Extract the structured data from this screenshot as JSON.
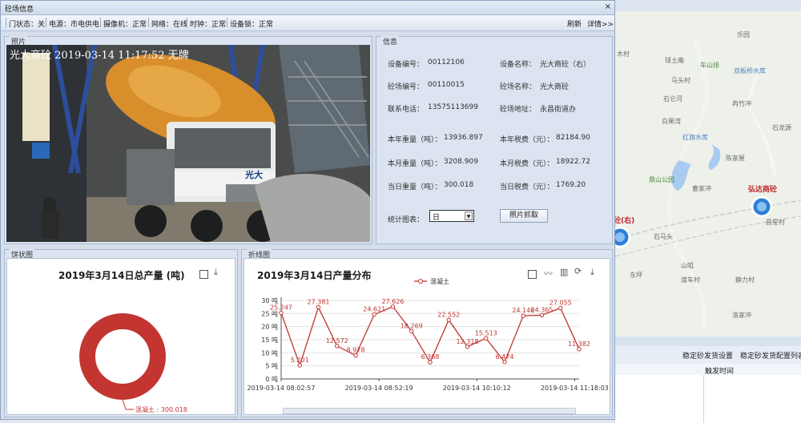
{
  "window": {
    "title": "砼场信息",
    "close": "×"
  },
  "status": {
    "door": "门状态：关",
    "power": "电源：市电供电",
    "camera": "摄像机：正常",
    "network": "网络：在线",
    "clock": "时钟：正常",
    "lock": "设备锁：正常",
    "refresh": "刷新",
    "details": "详情>>"
  },
  "photo": {
    "panel_title": "照片",
    "overlay": "光大商砼 2019-03-14 11:17:52 无牌",
    "truck_text": "光大"
  },
  "info": {
    "panel_title": "信息",
    "fields": [
      {
        "label": "设备编号：",
        "value": "00112106"
      },
      {
        "label": "设备名称：",
        "value": "光大商砼（右）"
      },
      {
        "label": "砼场编号：",
        "value": "00110015"
      },
      {
        "label": "砼场名称：",
        "value": "光大商砼"
      },
      {
        "label": "联系电话：",
        "value": "13575113699"
      },
      {
        "label": "砼场地址：",
        "value": "永昌街道办"
      },
      {
        "label": "本年重量（吨）：",
        "value": "13936.897"
      },
      {
        "label": "本年税费（元）：",
        "value": "82184.90"
      },
      {
        "label": "本月重量（吨）：",
        "value": "3208.909"
      },
      {
        "label": "本月税费（元）：",
        "value": "18922.72"
      },
      {
        "label": "当日重量（吨）：",
        "value": "300.018"
      },
      {
        "label": "当日税费（元）：",
        "value": "1769.20"
      }
    ],
    "stat_label": "统计图表：",
    "stat_value": "日",
    "snap_button": "照片抓取"
  },
  "pie_panel": {
    "panel_title": "饼状图"
  },
  "line_panel": {
    "panel_title": "折线图"
  },
  "map": {
    "labels": [
      "乐园",
      "球土庵",
      "车山排",
      "双板桥水库",
      "石仑河",
      "白果湾",
      "冉竹冲",
      "红旗水库",
      "陈家屋",
      "鼎山公园",
      "曹家冲",
      "石马头",
      "弘达商砼",
      "昌星村",
      "山咀",
      "渡车村",
      "静力村",
      "洛家冲",
      "东坪",
      "木村",
      "马头村",
      "石龙源"
    ],
    "brand": "弘达商砼",
    "partial": "砼(右)"
  },
  "bottom_panel": {
    "button1": "稳定砂发货设置",
    "button2": "稳定砂发货配置列表",
    "col": "触发时间"
  },
  "chart_data": [
    {
      "type": "pie",
      "title": "2019年3月14日总产量 (吨)",
      "slices": [
        {
          "name": "混凝土",
          "value": 300.018
        }
      ],
      "label": "混凝土 : 300.018",
      "color": "#c23531"
    },
    {
      "type": "line",
      "title": "2019年3月14日产量分布",
      "series": [
        {
          "name": "混凝土",
          "values": [
            25.247,
            5.201,
            27.381,
            12.572,
            8.978,
            24.621,
            27.626,
            18.269,
            6.368,
            22.552,
            12.318,
            15.513,
            6.474,
            24.146,
            24.365,
            27.055,
            11.382
          ]
        }
      ],
      "x_ticks": [
        "2019-03-14 08:02:57",
        "2019-03-14 08:52:19",
        "2019-03-14 10:10:12",
        "2019-03-14 11:18:03"
      ],
      "y_ticks": [
        "0 吨",
        "5 吨",
        "10 吨",
        "15 吨",
        "20 吨",
        "25 吨",
        "30 吨"
      ],
      "ylim": [
        0,
        30
      ],
      "grid": true,
      "legend": "top",
      "color": "#c23531"
    }
  ]
}
